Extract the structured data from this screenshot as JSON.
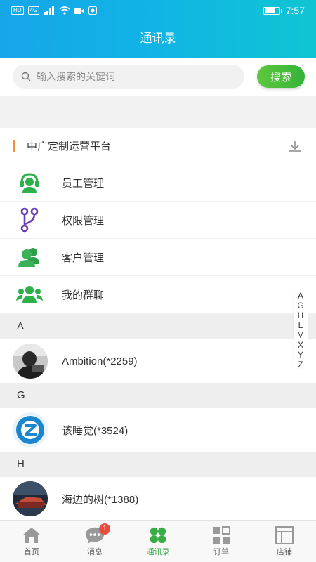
{
  "status_bar": {
    "left_badges": [
      "HD",
      "4G"
    ],
    "time": "7:57"
  },
  "header": {
    "title": "通讯录"
  },
  "search": {
    "placeholder": "输入搜索的关键词",
    "button": "搜索"
  },
  "org": {
    "name": "中广定制运营平台"
  },
  "menu": [
    {
      "label": "员工管理",
      "icon": "headset-agent-icon"
    },
    {
      "label": "权限管理",
      "icon": "branch-icon"
    },
    {
      "label": "客户管理",
      "icon": "users-icon"
    },
    {
      "label": "我的群聊",
      "icon": "group-chat-icon"
    }
  ],
  "sections": [
    {
      "letter": "A",
      "contacts": [
        {
          "name": "Ambition(*2259)"
        }
      ]
    },
    {
      "letter": "G",
      "contacts": [
        {
          "name": "该睡觉(*3524)"
        }
      ]
    },
    {
      "letter": "H",
      "contacts": [
        {
          "name": "海边的树(*1388)"
        }
      ]
    }
  ],
  "index_letters": [
    "A",
    "G",
    "H",
    "L",
    "M",
    "X",
    "Y",
    "Z"
  ],
  "tabs": [
    {
      "label": "首页",
      "icon": "home-icon"
    },
    {
      "label": "消息",
      "icon": "message-icon",
      "badge": "1"
    },
    {
      "label": "通讯录",
      "icon": "contacts-icon",
      "active": true
    },
    {
      "label": "订单",
      "icon": "order-icon"
    },
    {
      "label": "店铺",
      "icon": "shop-icon"
    }
  ],
  "colors": {
    "header_start": "#17a6e8",
    "header_end": "#10c5d2",
    "accent_green": "#3aac46",
    "org_bar": "#f2913a",
    "badge": "#e94b3c"
  }
}
